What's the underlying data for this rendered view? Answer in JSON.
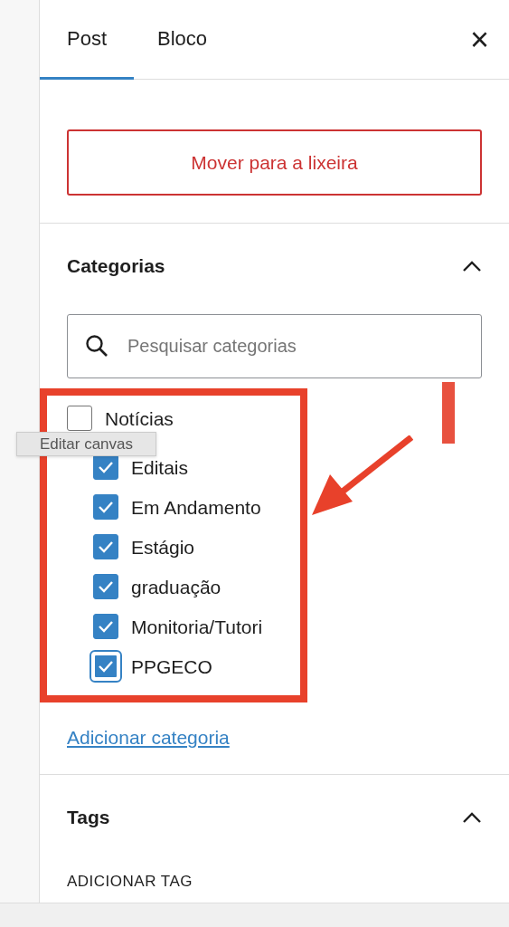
{
  "tabs": [
    {
      "label": "Post",
      "selected": true
    },
    {
      "label": "Bloco",
      "selected": false
    }
  ],
  "close_button": {
    "label": "×"
  },
  "trash_button": {
    "label": "Mover para a lixeira"
  },
  "categories_panel": {
    "title": "Categorias",
    "expanded": true,
    "search": {
      "placeholder": "Pesquisar categorias"
    },
    "items": [
      {
        "label": "Notícias",
        "checked": false,
        "focused": false,
        "children": [
          {
            "label": "Editais",
            "checked": true,
            "focused": false
          },
          {
            "label": "Em Andamento",
            "checked": true,
            "focused": false
          },
          {
            "label": "Estágio",
            "checked": true,
            "focused": false
          },
          {
            "label": "graduação",
            "checked": true,
            "focused": false
          },
          {
            "label": "Monitoria/Tutori",
            "checked": true,
            "focused": false
          },
          {
            "label": "PPGECO",
            "checked": true,
            "focused": true
          }
        ]
      }
    ],
    "add_link": "Adicionar categoria"
  },
  "tags_panel": {
    "title": "Tags",
    "expanded": true,
    "add_label": "ADICIONAR TAG"
  },
  "tooltip": "Editar canvas"
}
